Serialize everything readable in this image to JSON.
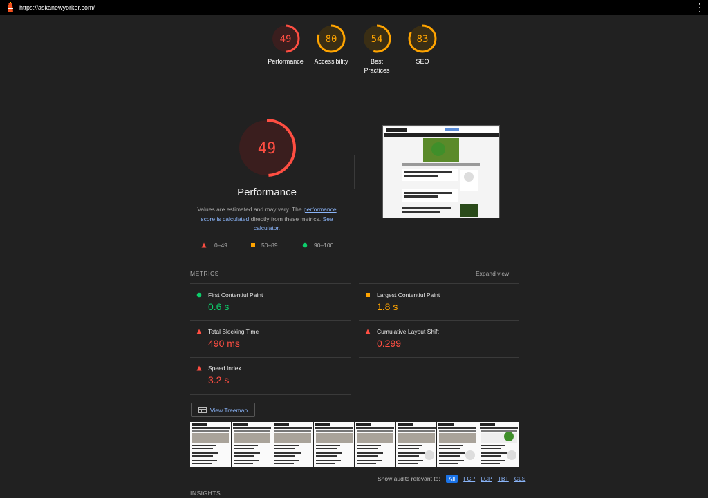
{
  "topbar": {
    "url": "https://askanewyorker.com/"
  },
  "categories": [
    {
      "label": "Performance",
      "score": "49",
      "color": "#ff4e42",
      "bg": "#3a1e1e"
    },
    {
      "label": "Accessibility",
      "score": "80",
      "color": "#ffa400",
      "bg": "#3a2e14"
    },
    {
      "label": "Best Practices",
      "score": "54",
      "color": "#ffa400",
      "bg": "#3a2e14"
    },
    {
      "label": "SEO",
      "score": "83",
      "color": "#ffa400",
      "bg": "#3a2e14"
    }
  ],
  "main": {
    "score": "49",
    "title": "Performance",
    "desc_prefix": "Values are estimated and may vary. The ",
    "desc_link1": "performance score is calculated",
    "desc_middle": " directly from these metrics. ",
    "desc_link2": "See calculator.",
    "legend": [
      {
        "range": "0–49",
        "shape": "triangle",
        "color": "#ff4e42"
      },
      {
        "range": "50–89",
        "shape": "square",
        "color": "#ffa400"
      },
      {
        "range": "90–100",
        "shape": "circle",
        "color": "#0cce6b"
      }
    ]
  },
  "metrics": {
    "header": "METRICS",
    "expand": "Expand view",
    "items": [
      {
        "name": "First Contentful Paint",
        "value": "0.6 s",
        "status": "green"
      },
      {
        "name": "Largest Contentful Paint",
        "value": "1.8 s",
        "status": "orange"
      },
      {
        "name": "Total Blocking Time",
        "value": "490 ms",
        "status": "red"
      },
      {
        "name": "Cumulative Layout Shift",
        "value": "0.299",
        "status": "red"
      },
      {
        "name": "Speed Index",
        "value": "3.2 s",
        "status": "red"
      }
    ]
  },
  "treemap": {
    "label": "View Treemap"
  },
  "audits": {
    "label": "Show audits relevant to:",
    "filters": [
      "All",
      "FCP",
      "LCP",
      "TBT",
      "CLS"
    ],
    "active": "All"
  },
  "insights": {
    "header": "INSIGHTS"
  },
  "icons": {
    "logo": "lighthouse-icon",
    "menu": "kebab-menu-icon",
    "treemap": "treemap-icon"
  }
}
